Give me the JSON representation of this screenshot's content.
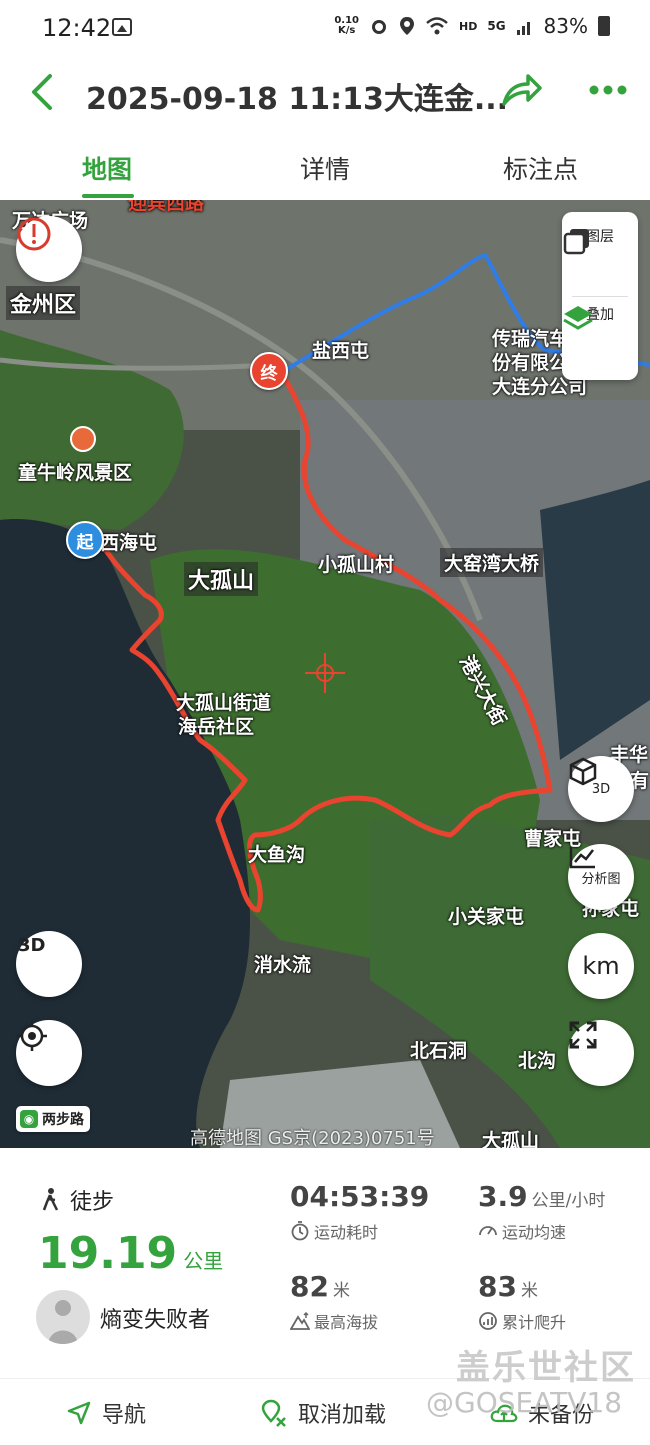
{
  "status": {
    "time": "12:42",
    "net_speed_value": "0.10",
    "net_speed_unit": "K/s",
    "hd": "HD",
    "net_type": "5G",
    "battery": "83%"
  },
  "header": {
    "title": "2025-09-18 11:13大连金..."
  },
  "tabs": [
    "地图",
    "详情",
    "标注点"
  ],
  "map": {
    "layer_panel": {
      "layers_label": "图层",
      "overlay_label": "叠加"
    },
    "controls": {
      "three_d": "3D",
      "analysis": "分析图",
      "km": "km"
    },
    "markers": {
      "start": "起",
      "end": "终"
    },
    "labels": [
      "万达广场",
      "金州区",
      "盐西屯",
      "传瑞汽车",
      "份有限公",
      "大连分公司",
      "童牛岭风景区",
      "西海屯",
      "大孤山",
      "小孤山村",
      "大窑湾大桥",
      "港兴大街",
      "大孤山街道",
      "海岳社区",
      "丰华",
      "有",
      "曹家屯",
      "大鱼沟",
      "小关家屯",
      "孙家屯",
      "消水流",
      "北石洞",
      "北沟",
      "大孤山",
      "迎宾西路"
    ],
    "brand": "两步路",
    "copyright": "高德地图 GS京(2023)0751号"
  },
  "summary": {
    "sport": "徒步",
    "distance": "19.19",
    "distance_unit": "公里",
    "user": "熵变失败者",
    "stats": [
      {
        "value": "04:53:39",
        "unit": "",
        "label": "运动耗时",
        "icon": "stopwatch-icon"
      },
      {
        "value": "3.9",
        "unit": "公里/小时",
        "label": "运动均速",
        "icon": "speedometer-icon"
      },
      {
        "value": "82",
        "unit": "米",
        "label": "最高海拔",
        "icon": "mountain-icon"
      },
      {
        "value": "83",
        "unit": "米",
        "label": "累计爬升",
        "icon": "climb-icon"
      }
    ]
  },
  "actions": {
    "navigate": "导航",
    "cancel_load": "取消加载",
    "bookmark": "未备份"
  },
  "watermark": {
    "line1": "盖乐世社区",
    "line2": "@GOSEATV18"
  },
  "colors": {
    "accent": "#35a33d",
    "track": "#e8442f",
    "route_blue": "#2f7de8"
  }
}
